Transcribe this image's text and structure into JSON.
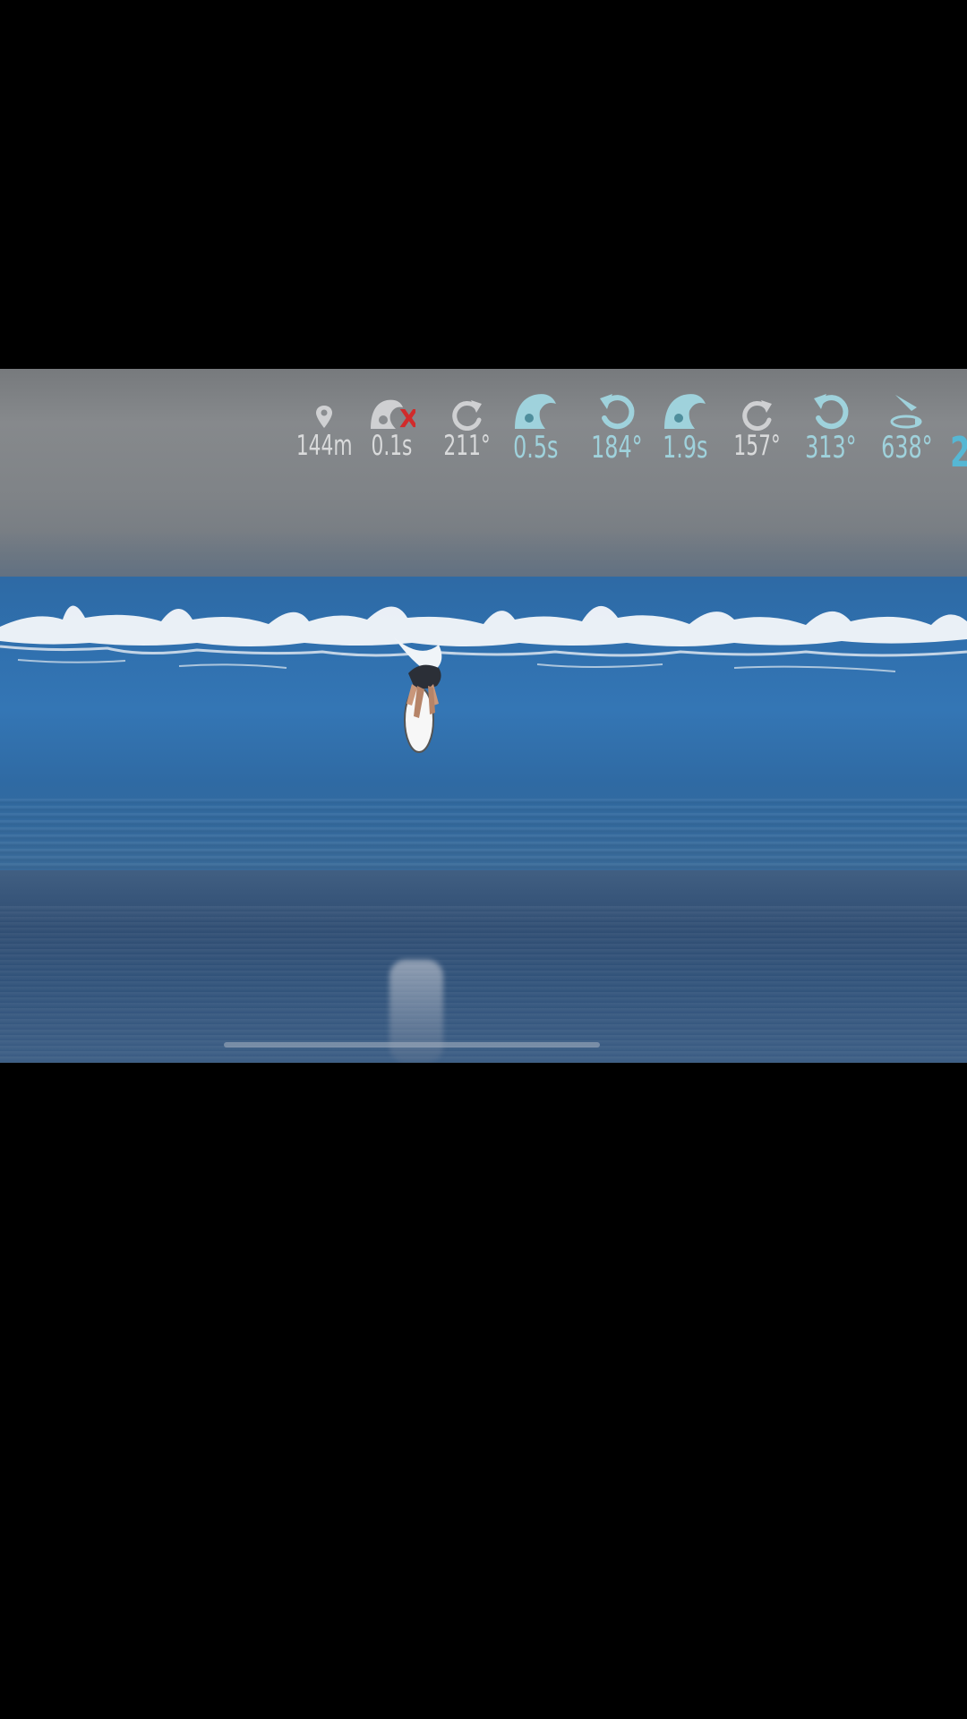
{
  "hud": {
    "stats": [
      {
        "icon": "location-pin-icon",
        "value": "144m",
        "style": "grey"
      },
      {
        "icon": "barrel-fail-icon",
        "value": "0.1s",
        "style": "grey",
        "mark": "X"
      },
      {
        "icon": "rotate-right-icon",
        "value": "211°",
        "style": "grey"
      },
      {
        "icon": "barrel-icon",
        "value": "0.5s",
        "style": "teal"
      },
      {
        "icon": "rotate-left-icon",
        "value": "184°",
        "style": "teal"
      },
      {
        "icon": "barrel-icon",
        "value": "1.9s",
        "style": "teal"
      },
      {
        "icon": "rotate-right-icon",
        "value": "157°",
        "style": "grey"
      },
      {
        "icon": "rotate-left-icon",
        "value": "313°",
        "style": "teal"
      },
      {
        "icon": "aerial-spin-icon",
        "value": "638°",
        "style": "teal"
      }
    ],
    "edge_value": "2"
  },
  "colors": {
    "hud_grey": "#d9dadb",
    "hud_teal": "#9fd2dc",
    "hud_edge": "#56b7d4",
    "fail_mark": "#d12b2b",
    "wave_blue": "#2f6fad"
  }
}
